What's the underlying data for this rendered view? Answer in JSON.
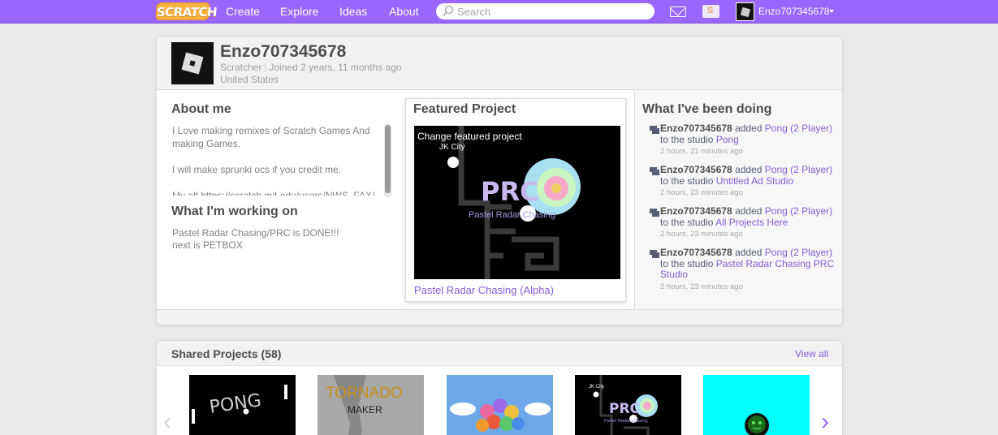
{
  "header": {
    "logo": "SCRATCH",
    "nav": [
      "Create",
      "Explore",
      "Ideas",
      "About"
    ],
    "search_placeholder": "Search",
    "username": "Enzo707345678"
  },
  "profile": {
    "username": "Enzo707345678",
    "role": "Scratcher",
    "joined": "Joined 2 years, 11 months ago",
    "country": "United States"
  },
  "about": {
    "title": "About me",
    "paragraphs": [
      "I Love making remixes of Scratch Games And making Games.",
      "I will make sprunki ocs if you credit me.",
      "My alt https://scratch.mit.edu/users/NWS_FAX/"
    ]
  },
  "working": {
    "title": "What I'm working on",
    "lines": [
      "Pastel Radar Chasing/PRC is DONE!!!",
      "next is PETBOX"
    ]
  },
  "featured": {
    "title": "Featured Project",
    "change_label": "Change featured project",
    "project_title": "Pastel Radar Chasing (Alpha)",
    "thumb_city": "JK City",
    "thumb_logo": "PRC",
    "thumb_subtitle": "Pastel Radar Chasing"
  },
  "activity": {
    "title": "What I've been doing",
    "items": [
      {
        "user": "Enzo707345678",
        "verb": "added",
        "project": "Pong (2 Player)",
        "mid": "to the studio",
        "studio": "Pong",
        "time": "2 hours, 21 minutes ago"
      },
      {
        "user": "Enzo707345678",
        "verb": "added",
        "project": "Pong (2 Player)",
        "mid": "to the studio",
        "studio": "Untitled Ad Studio",
        "time": "2 hours, 23 minutes ago"
      },
      {
        "user": "Enzo707345678",
        "verb": "added",
        "project": "Pong (2 Player)",
        "mid": "to the studio",
        "studio": "All Projects Here",
        "time": "2 hours, 23 minutes ago"
      },
      {
        "user": "Enzo707345678",
        "verb": "added",
        "project": "Pong (2 Player)",
        "mid": "to the studio",
        "studio": "Pastel Radar Chasing PRC Studio",
        "time": "2 hours, 23 minutes ago"
      }
    ]
  },
  "shared": {
    "title": "Shared Projects (58)",
    "view_all": "View all",
    "thumbs": [
      {
        "text": "PONG"
      },
      {
        "text": "TORNADO",
        "sub": "MAKER"
      },
      {
        "text": ""
      },
      {
        "text": "PRC",
        "city": "JK City",
        "sub": "Pastel Radar Chasing"
      },
      {
        "text": ""
      }
    ],
    "prev_arrow": "‹",
    "next_arrow": "›"
  },
  "colors": {
    "brand": "#9966ff",
    "link": "#855cd6",
    "logo": "#f7b33e"
  }
}
